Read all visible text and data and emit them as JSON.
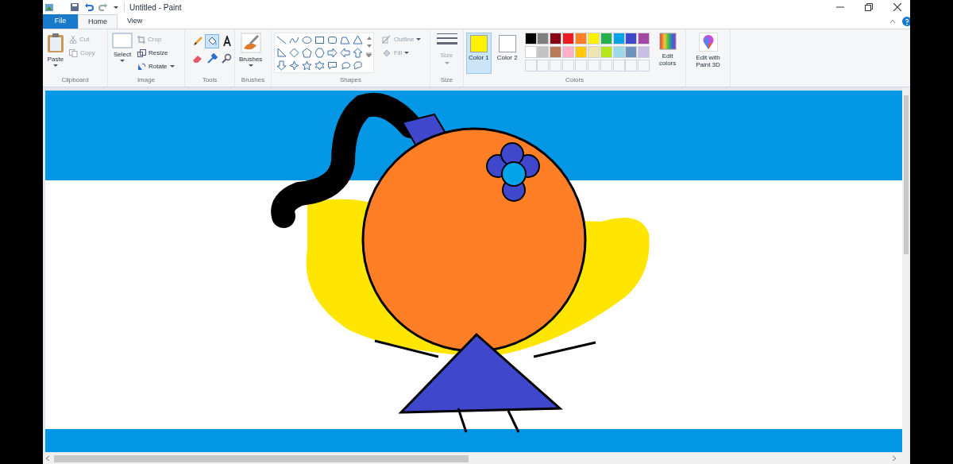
{
  "window": {
    "title": "Untitled - Paint"
  },
  "tabs": [
    {
      "label": "File",
      "kind": "file",
      "selected": false
    },
    {
      "label": "Home",
      "kind": "tab",
      "selected": true
    },
    {
      "label": "View",
      "kind": "tab",
      "selected": false
    }
  ],
  "clipboard": {
    "label": "Clipboard",
    "paste": "Paste",
    "cut": {
      "label": "Cut",
      "disabled": true
    },
    "copy": {
      "label": "Copy",
      "disabled": true
    }
  },
  "image": {
    "label": "Image",
    "select": "Select",
    "crop": {
      "label": "Crop",
      "disabled": true
    },
    "resize": {
      "label": "Resize",
      "disabled": false
    },
    "rotate": {
      "label": "Rotate",
      "disabled": false
    }
  },
  "tools": {
    "label": "Tools",
    "items": [
      {
        "kind": "pencil",
        "selected": false
      },
      {
        "kind": "fill",
        "selected": true
      },
      {
        "kind": "text",
        "selected": false
      },
      {
        "kind": "eraser",
        "selected": false
      },
      {
        "kind": "picker",
        "selected": false
      },
      {
        "kind": "magnifier",
        "selected": false
      }
    ]
  },
  "brushes": {
    "label": "Brushes",
    "button": "Brushes"
  },
  "shapes": {
    "label": "Shapes",
    "outline": {
      "label": "Outline",
      "disabled": true
    },
    "fill": {
      "label": "Fill",
      "disabled": true
    }
  },
  "size": {
    "label": "Size",
    "button": "Size",
    "disabled": true
  },
  "colors": {
    "label": "Colors",
    "color1": {
      "label": "Color 1",
      "color": "#fff200",
      "selected": true
    },
    "color2": {
      "label": "Color 2",
      "color": "#ffffff",
      "selected": false
    },
    "palette": [
      {
        "kind": "swatch",
        "color": "#000000"
      },
      {
        "kind": "swatch",
        "color": "#7f7f7f"
      },
      {
        "kind": "swatch",
        "color": "#880015"
      },
      {
        "kind": "swatch",
        "color": "#ed1c24"
      },
      {
        "kind": "swatch",
        "color": "#ff7f27"
      },
      {
        "kind": "swatch",
        "color": "#fff200"
      },
      {
        "kind": "swatch",
        "color": "#22b14c"
      },
      {
        "kind": "swatch",
        "color": "#00a2e8"
      },
      {
        "kind": "swatch",
        "color": "#3f48cc"
      },
      {
        "kind": "swatch",
        "color": "#a349a4"
      },
      {
        "kind": "swatch",
        "color": "#ffffff"
      },
      {
        "kind": "swatch",
        "color": "#c3c3c3"
      },
      {
        "kind": "swatch",
        "color": "#b97a57"
      },
      {
        "kind": "swatch",
        "color": "#ffaec9"
      },
      {
        "kind": "swatch",
        "color": "#ffc90e"
      },
      {
        "kind": "swatch",
        "color": "#efe4b0"
      },
      {
        "kind": "swatch",
        "color": "#b5e61d"
      },
      {
        "kind": "swatch",
        "color": "#99d9ea"
      },
      {
        "kind": "swatch",
        "color": "#7092be"
      },
      {
        "kind": "swatch",
        "color": "#c8bfe7"
      },
      {
        "kind": "empty"
      },
      {
        "kind": "empty"
      },
      {
        "kind": "empty"
      },
      {
        "kind": "empty"
      },
      {
        "kind": "empty"
      },
      {
        "kind": "empty"
      },
      {
        "kind": "empty"
      },
      {
        "kind": "empty"
      },
      {
        "kind": "empty"
      },
      {
        "kind": "empty"
      }
    ],
    "edit_colors": "Edit colors"
  },
  "paint3d": {
    "label": "Edit with Paint 3D"
  }
}
